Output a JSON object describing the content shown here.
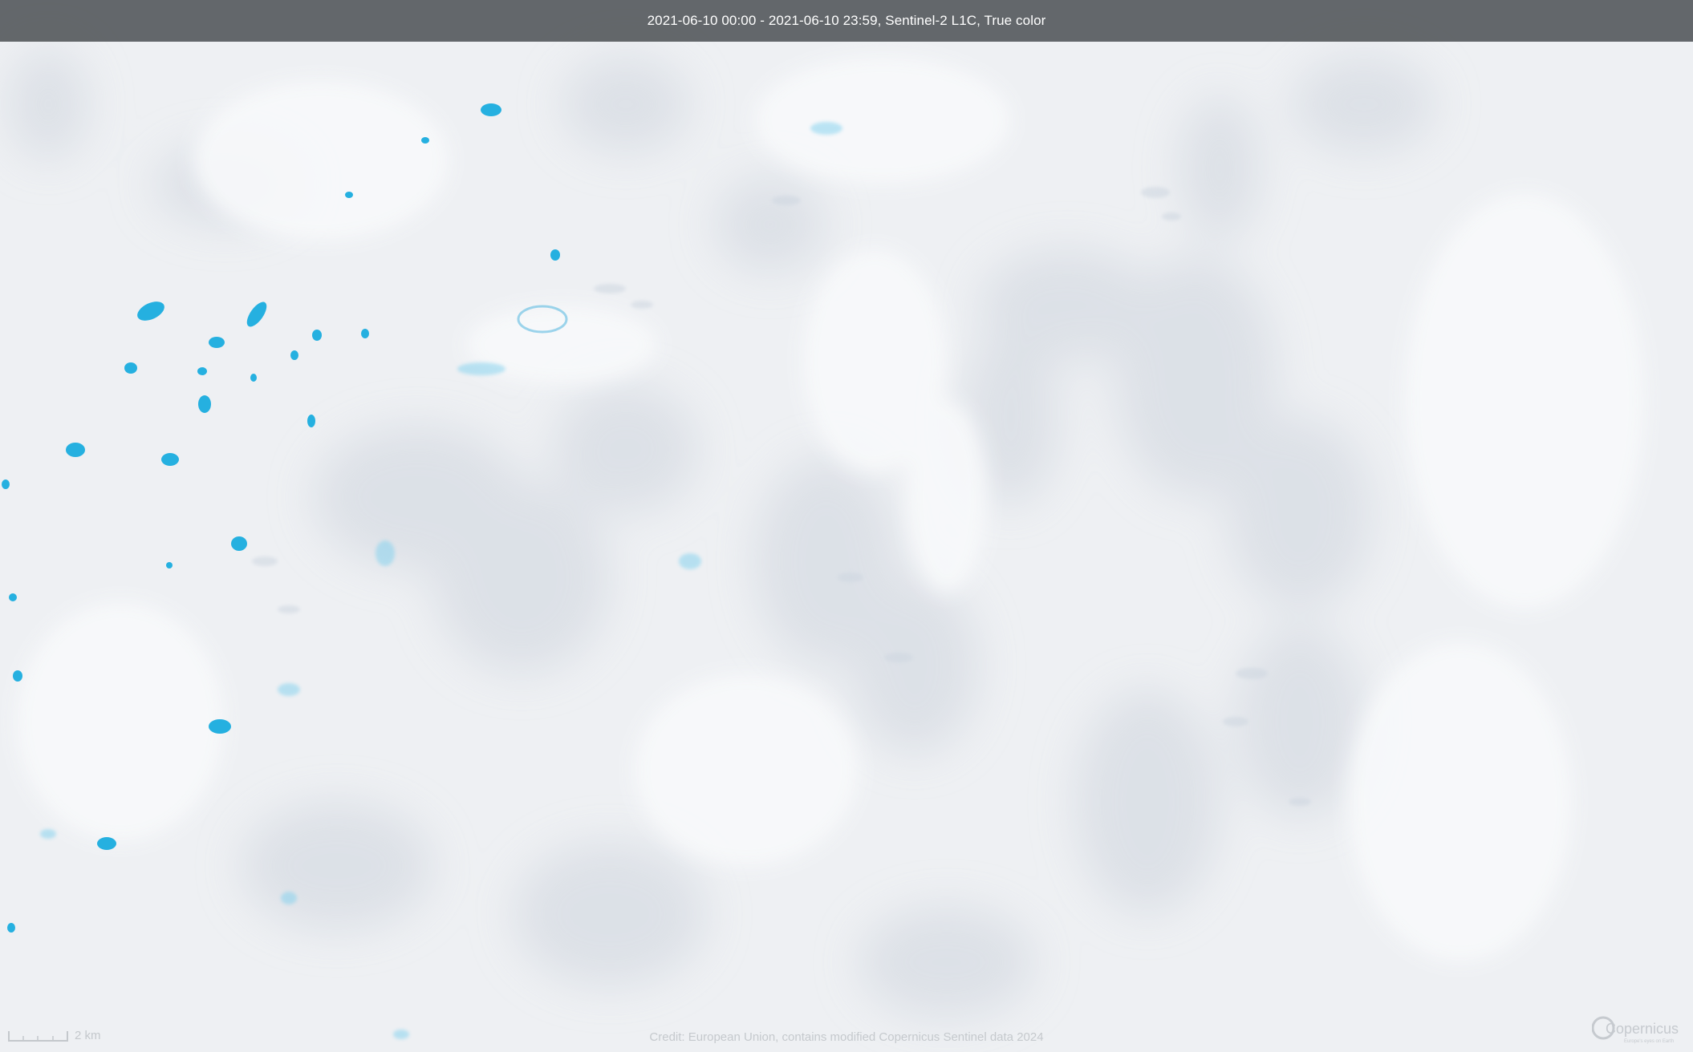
{
  "header": {
    "caption": "2021-06-10 00:00 - 2021-06-10 23:59, Sentinel-2 L1C, True color"
  },
  "scale_bar": {
    "label": "2 km"
  },
  "credit": {
    "text": "Credit: European Union, contains modified Copernicus Sentinel data 2024"
  },
  "logo": {
    "text": "Copernicus",
    "subtext": "Europe's eyes on Earth"
  },
  "colors": {
    "ice": "#eef0f3",
    "meltwater": "#25b0e0",
    "header_bar": "#585c60"
  }
}
